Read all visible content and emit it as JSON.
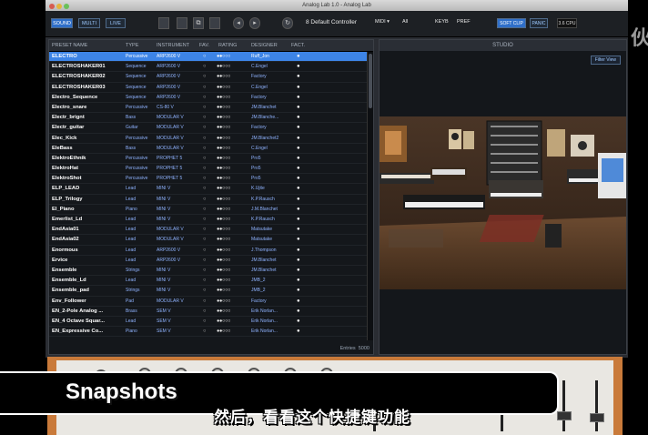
{
  "window": {
    "title": "Analog Lab 1.0 - Analog Lab"
  },
  "toolbar": {
    "tabs": [
      "SOUND",
      "MULTI",
      "LIVE"
    ],
    "controller": "8 Default Controller",
    "midi": "MIDI ▾",
    "all": "All",
    "keys": "KEYB",
    "pref": "PREF",
    "soft_clip": "SOFT CLIP",
    "panic": "PANIC",
    "cpu": "3.6 CPU"
  },
  "list": {
    "headers": [
      "PRESET NAME",
      "TYPE",
      "INSTRUMENT",
      "FAV.",
      "RATING",
      "DESIGNER",
      "FACT."
    ],
    "rows": [
      [
        "ELECTRO",
        "Percussive",
        "ARP2600 V",
        "○",
        "●●○○○",
        "Ruff_Jon",
        "●"
      ],
      [
        "ELECTROSHAKER01",
        "Sequence",
        "ARP2600 V",
        "○",
        "●●○○○",
        "C.Engel",
        "●"
      ],
      [
        "ELECTROSHAKER02",
        "Sequence",
        "ARP2600 V",
        "○",
        "●●○○○",
        "Factory",
        "●"
      ],
      [
        "ELECTROSHAKER03",
        "Sequence",
        "ARP2600 V",
        "○",
        "●●○○○",
        "C.Engel",
        "●"
      ],
      [
        "Electro_Sequence",
        "Sequence",
        "ARP2600 V",
        "○",
        "●●○○○",
        "Factory",
        "●"
      ],
      [
        "Electro_snare",
        "Percussive",
        "CS-80 V",
        "○",
        "●●○○○",
        "JM.Blanchet",
        "●"
      ],
      [
        "Electr_brignt",
        "Bass",
        "MODULAR V",
        "○",
        "●●○○○",
        "JM.Blanche...",
        "●"
      ],
      [
        "Electr_guitar",
        "Guitar",
        "MODULAR V",
        "○",
        "●●○○○",
        "Factory",
        "●"
      ],
      [
        "Elec_Kick",
        "Percussive",
        "MODULAR V",
        "○",
        "●●○○○",
        "JM.Blanchet2",
        "●"
      ],
      [
        "EleBass",
        "Bass",
        "MODULAR V",
        "○",
        "●●○○○",
        "C.Engel",
        "●"
      ],
      [
        "ElektroEthnik",
        "Percussive",
        "PROPHET 5",
        "○",
        "●●○○○",
        "Pro5",
        "●"
      ],
      [
        "ElektroHat",
        "Percussive",
        "PROPHET 5",
        "○",
        "●●○○○",
        "Pro5",
        "●"
      ],
      [
        "ElektroShot",
        "Percussive",
        "PROPHET 5",
        "○",
        "●●○○○",
        "Pro5",
        "●"
      ],
      [
        "ELP_LEAD",
        "Lead",
        "MINI V",
        "○",
        "●●○○○",
        "K.Ujite",
        "●"
      ],
      [
        "ELP_Trilogy",
        "Lead",
        "MINI V",
        "○",
        "●●○○○",
        "K.P.Rausch",
        "●"
      ],
      [
        "El_Piano",
        "Piano",
        "MINI V",
        "○",
        "●●○○○",
        "J.M.Blanchet",
        "●"
      ],
      [
        "Emerlist_Ld",
        "Lead",
        "MINI V",
        "○",
        "●●○○○",
        "K.P.Rausch",
        "●"
      ],
      [
        "EndAsia01",
        "Lead",
        "MODULAR V",
        "○",
        "●●○○○",
        "Matsutake",
        "●"
      ],
      [
        "EndAsia02",
        "Lead",
        "MODULAR V",
        "○",
        "●●○○○",
        "Matsutake",
        "●"
      ],
      [
        "Enormous",
        "Lead",
        "ARP2600 V",
        "○",
        "●●○○○",
        "J.Thompson",
        "●"
      ],
      [
        "Ervice",
        "Lead",
        "ARP2600 V",
        "○",
        "●●○○○",
        "JM.Blanchet",
        "●"
      ],
      [
        "Ensemble",
        "Strings",
        "MINI V",
        "○",
        "●●○○○",
        "JM.Blanchet",
        "●"
      ],
      [
        "Ensemble_Ld",
        "Lead",
        "MINI V",
        "○",
        "●●○○○",
        "JMB_2",
        "●"
      ],
      [
        "Ensemble_pad",
        "Strings",
        "MINI V",
        "○",
        "●●○○○",
        "JMB_2",
        "●"
      ],
      [
        "Env_Follower",
        "Pad",
        "MODULAR V",
        "○",
        "●●○○○",
        "Factory",
        "●"
      ],
      [
        "EN_2-Pole Analog ...",
        "Brass",
        "SEM V",
        "○",
        "●●○○○",
        "Erik Norlan...",
        "●"
      ],
      [
        "EN_4 Octave Squar...",
        "Lead",
        "SEM V",
        "○",
        "●●○○○",
        "Erik Norlan...",
        "●"
      ],
      [
        "EN_Expressive Co...",
        "Piano",
        "SEM V",
        "○",
        "●●○○○",
        "Erik Norlan...",
        "●"
      ]
    ],
    "entries_label": "Entries",
    "entries_count": "5000"
  },
  "studio": {
    "title": "STUDIO",
    "filter_button": "Filter View"
  },
  "overlay": {
    "banner": "Snapshots",
    "subtitle": "然后，看看这个快捷键功能",
    "side_char": "伙"
  }
}
